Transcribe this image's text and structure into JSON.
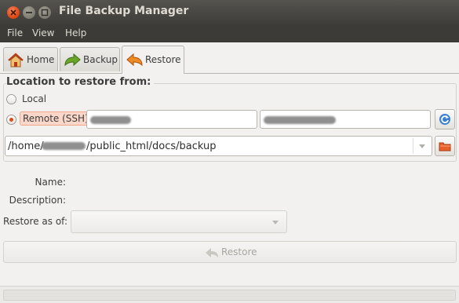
{
  "window": {
    "title": "File Backup Manager"
  },
  "menu": {
    "items": [
      "File",
      "View",
      "Help"
    ]
  },
  "tabs": [
    {
      "label": "Home",
      "icon": "home-icon"
    },
    {
      "label": "Backup",
      "icon": "backup-arrow-icon"
    },
    {
      "label": "Restore",
      "icon": "restore-arrow-icon",
      "active": true
    }
  ],
  "restore": {
    "group_label": "Location to restore from:",
    "options": [
      {
        "label": "Local",
        "selected": false
      },
      {
        "label": "Remote (SSH)",
        "selected": true
      }
    ],
    "path_prefix": "/home/",
    "path_suffix": "/public_html/docs/backup",
    "fields": {
      "name_label": "Name:",
      "description_label": "Description:",
      "restore_as_of_label": "Restore as of:"
    },
    "restore_button_label": "Restore"
  },
  "colors": {
    "accent": "#df4b16",
    "titlebar": "#3c3b37",
    "window_bg": "#f2f1f0"
  }
}
